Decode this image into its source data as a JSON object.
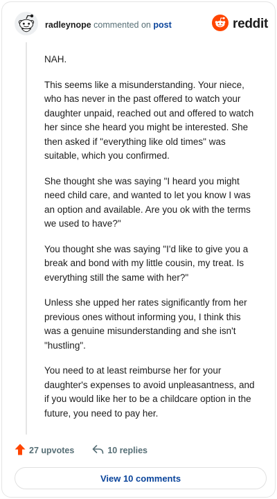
{
  "header": {
    "username": "radleynope",
    "verb": "commented on",
    "link_text": "post",
    "brand": "reddit"
  },
  "comment": {
    "paragraphs": [
      "NAH.",
      "This seems like a misunderstanding. Your niece, who has never in the past offered to watch your daughter unpaid, reached out and offered to watch her since she heard you might be interested. She then asked if \"everything like old times\" was suitable, which you confirmed.",
      "She thought she was saying \"I heard you might need child care, and wanted to let you know I was an option and available. Are you ok with the terms we used to have?\"",
      "You thought she was saying \"I'd like to give you a break and bond with my little cousin, my treat. Is everything still the same with her?\"",
      "Unless she upped her rates significantly from her previous ones without informing you, I think this was a genuine misunderstanding and she isn't \"hustling\".",
      "You need to at least reimburse her for your daughter's expenses to avoid unpleasantness, and if you would like her to be a childcare option in the future, you need to pay her."
    ]
  },
  "actions": {
    "upvotes": "27 upvotes",
    "replies": "10 replies"
  },
  "footer": {
    "view_comments": "View 10 comments"
  },
  "colors": {
    "brand": "#ff4500",
    "link": "#0a449b",
    "muted": "#576f76"
  },
  "icons": [
    "snoo-avatar-icon",
    "reddit-logo-icon",
    "upvote-arrow-icon",
    "reply-arrow-icon"
  ]
}
